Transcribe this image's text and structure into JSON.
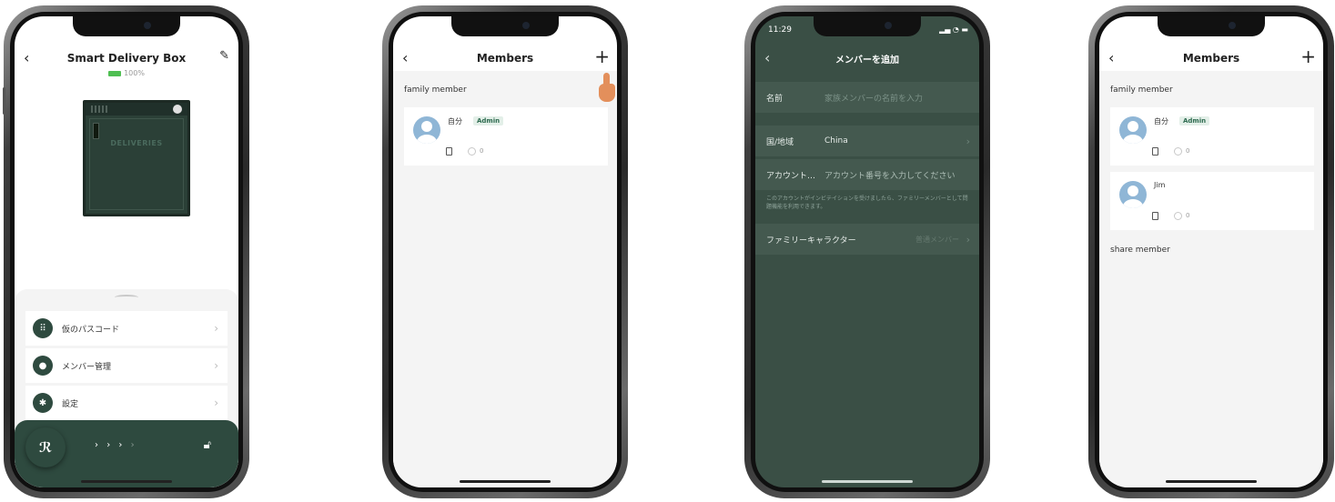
{
  "phone1": {
    "title": "Smart Delivery Box",
    "battery": "100%",
    "box_label": "DELIVERIES",
    "menu": [
      {
        "label": "仮のパスコード",
        "icon": "keypad-icon"
      },
      {
        "label": "メンバー管理",
        "icon": "person-icon"
      },
      {
        "label": "設定",
        "icon": "gear-icon"
      }
    ],
    "unlock_arrows": [
      "›",
      "›",
      "›",
      "›"
    ]
  },
  "phone2": {
    "title": "Members",
    "section": "family member",
    "members": [
      {
        "name": "自分",
        "badge": "Admin",
        "fingerprints": "0"
      }
    ]
  },
  "phone3": {
    "time": "11:29",
    "title": "メンバーを追加",
    "fields": {
      "name_label": "名前",
      "name_placeholder": "家族メンバーの名前を入力",
      "region_label": "国/地域",
      "region_value": "China",
      "account_label": "アカウント…",
      "account_placeholder": "アカウント番号を入力してください",
      "note": "このアカウントがインビテイションを受けましたら、ファミリーメンバーとして問題機能を利用できます。",
      "role_label": "ファミリーキャラクター",
      "role_value": "普通メンバー"
    }
  },
  "phone4": {
    "title": "Members",
    "section": "family member",
    "members": [
      {
        "name": "自分",
        "badge": "Admin",
        "fingerprints": "0"
      },
      {
        "name": "Jim",
        "badge": "",
        "fingerprints": "0"
      }
    ],
    "share_section": "share member"
  },
  "colors": {
    "accent": "#2e4a3f",
    "dark_screen": "#3a4f45",
    "badge_text": "#2e6b50",
    "pointer_hand": "#e38f5b"
  }
}
